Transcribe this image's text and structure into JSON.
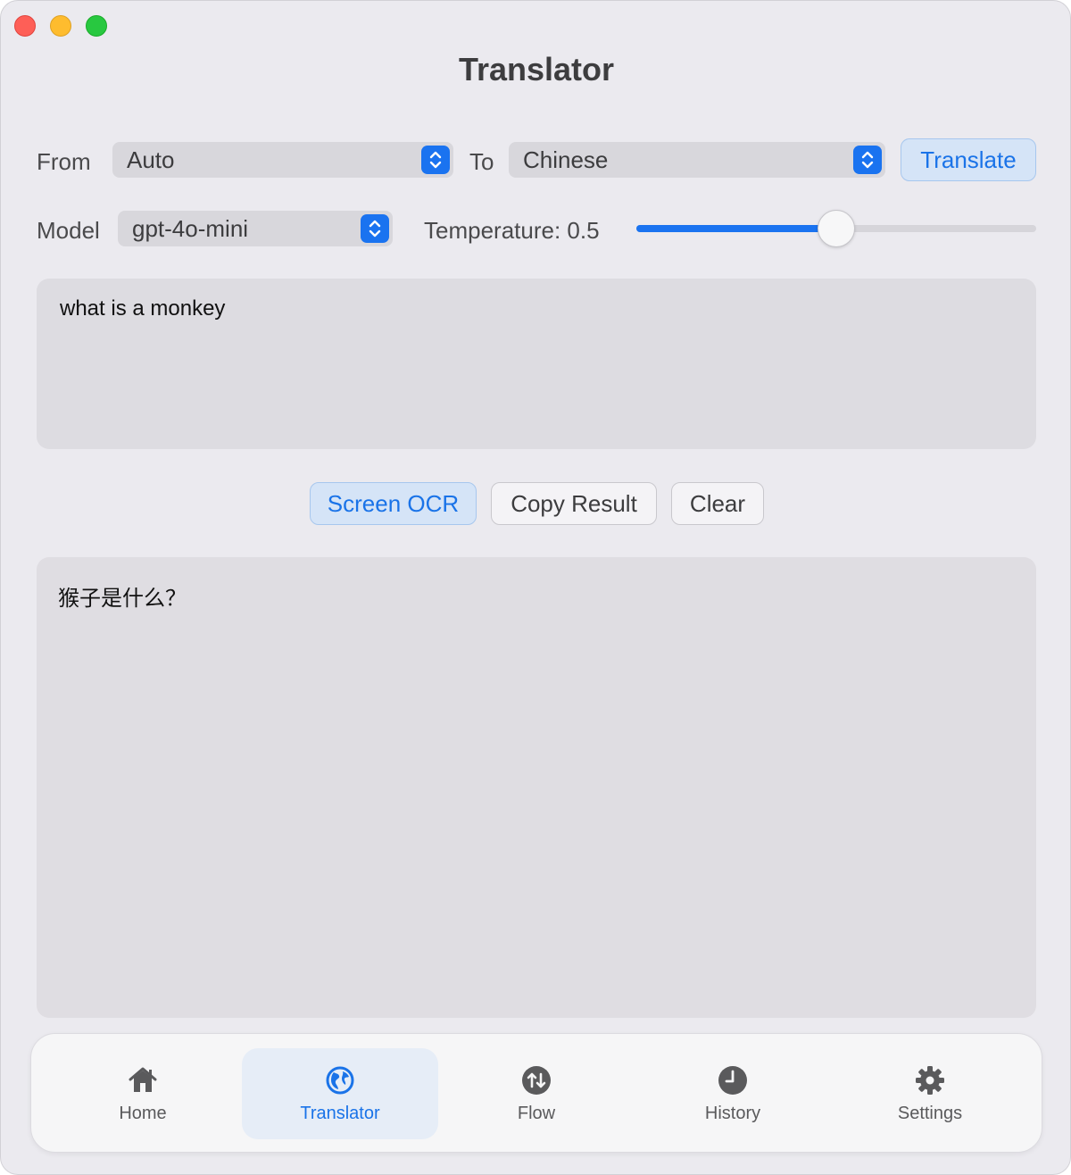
{
  "window": {
    "title": "Translator"
  },
  "controls": {
    "from_label": "From",
    "from_value": "Auto",
    "to_label": "To",
    "to_value": "Chinese",
    "translate_button": "Translate",
    "model_label": "Model",
    "model_value": "gpt-4o-mini",
    "temperature_label": "Temperature: 0.5",
    "temperature_value": 0.5
  },
  "input": {
    "text": "what is a monkey"
  },
  "actions": {
    "screen_ocr": "Screen OCR",
    "copy_result": "Copy Result",
    "clear": "Clear"
  },
  "output": {
    "text": "猴子是什么？"
  },
  "tabs": [
    {
      "label": "Home",
      "icon": "house-icon",
      "active": false
    },
    {
      "label": "Translator",
      "icon": "globe-icon",
      "active": true
    },
    {
      "label": "Flow",
      "icon": "arrows-up-down-icon",
      "active": false
    },
    {
      "label": "History",
      "icon": "clock-icon",
      "active": false
    },
    {
      "label": "Settings",
      "icon": "gear-icon",
      "active": false
    }
  ],
  "colors": {
    "accent": "#1a73e8",
    "close": "#fe5f57",
    "minimize": "#febc2e",
    "maximize": "#28c840"
  }
}
